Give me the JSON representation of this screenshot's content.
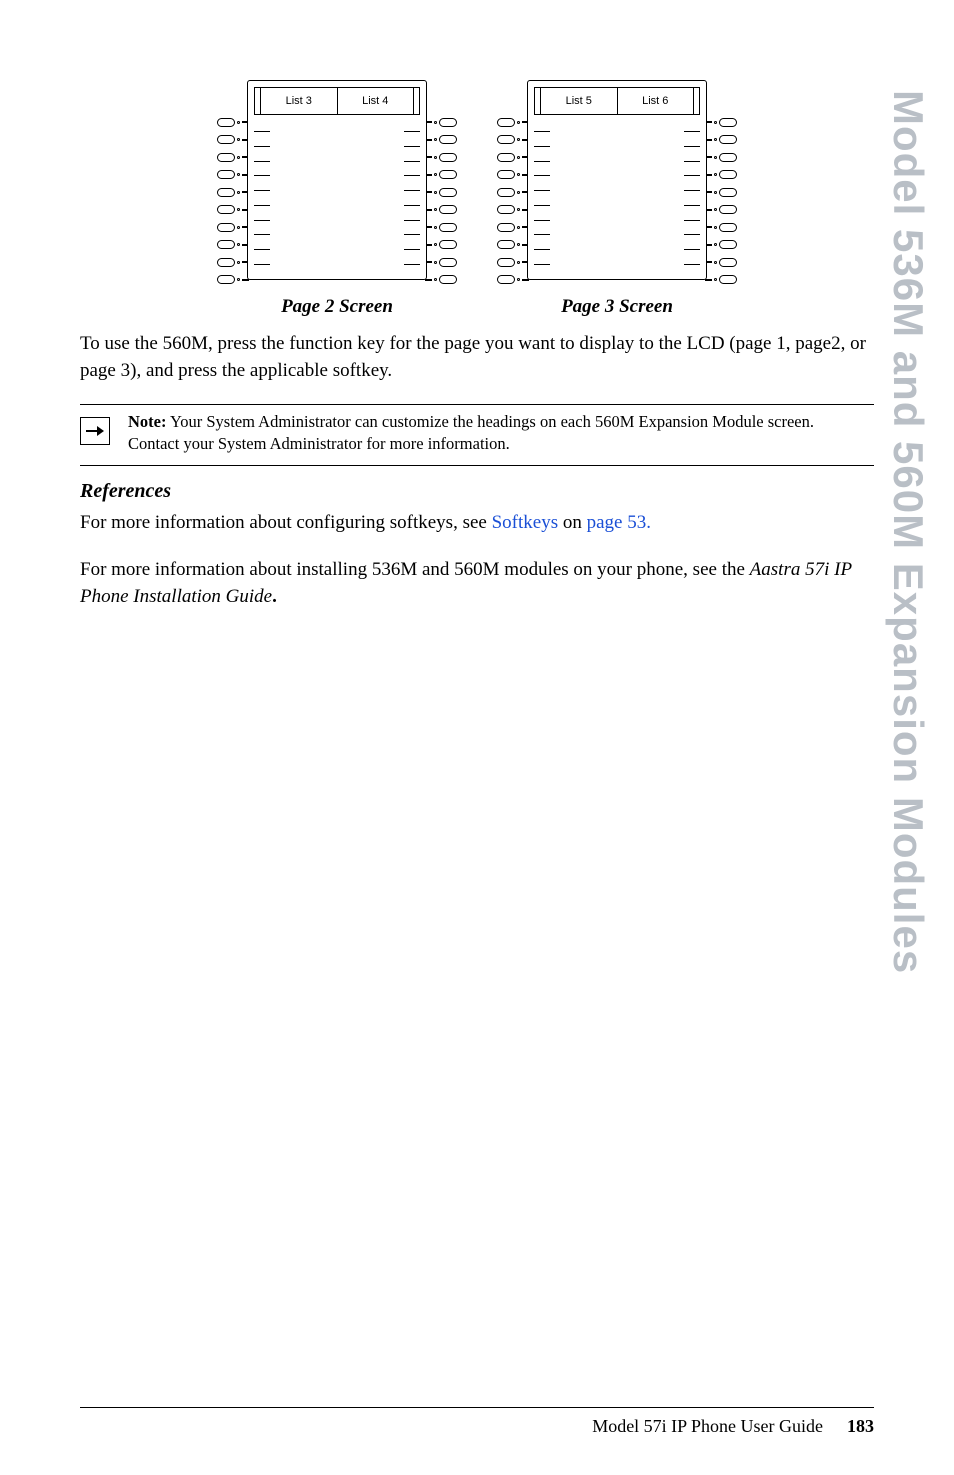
{
  "side_tab": "Model 536M and 560M Expansion Modules",
  "diagrams": {
    "left": {
      "cols": [
        "List 3",
        "List 4"
      ],
      "caption": "Page 2 Screen"
    },
    "right": {
      "cols": [
        "List 5",
        "List 6"
      ],
      "caption": "Page 3 Screen"
    }
  },
  "body": {
    "para1": "To use the 560M, press the function key for the page you want to display to the LCD (page 1, page2, or page 3), and press the applicable softkey."
  },
  "note": {
    "label": "Note:",
    "text": " Your System Administrator can customize the headings on each 560M Expansion Module screen. Contact your System Administrator for more information."
  },
  "references": {
    "heading": "References",
    "line1_pre": "For more information about configuring softkeys, see ",
    "line1_link1": "Softkeys",
    "line1_mid": " on ",
    "line1_link2": "page 53.",
    "line2_pre": "For more information about installing 536M and 560M modules on your phone, see the ",
    "line2_em": "Aastra 57i IP Phone Installation Guide",
    "line2_post": "."
  },
  "footer": {
    "guide": "Model 57i IP Phone User Guide",
    "page": "183"
  }
}
